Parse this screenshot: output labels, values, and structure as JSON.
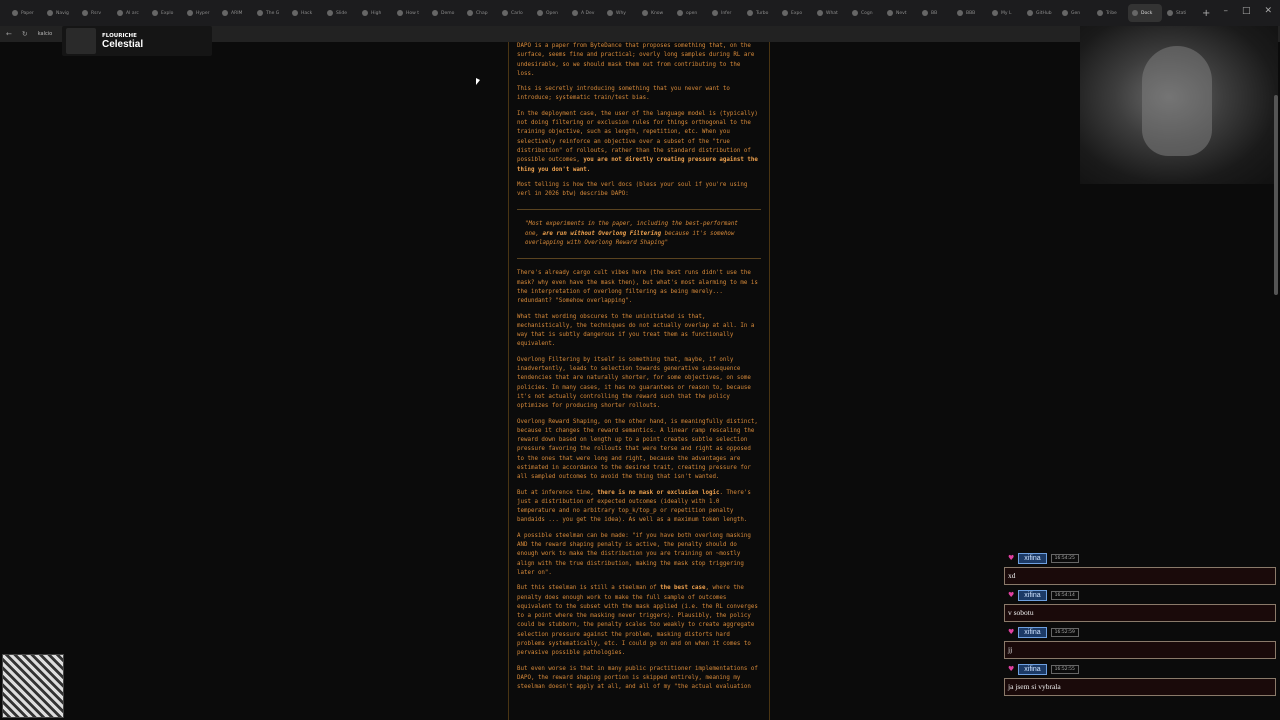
{
  "browser": {
    "tabs": [
      "Paper",
      "Navig",
      "Rsrv",
      "AI arc",
      "Explo",
      "Hyper",
      "ARIM",
      "The G",
      "Hack",
      "Slide",
      "High",
      "How t",
      "Demo",
      "Chap",
      "Carlo",
      "Open",
      "A Dev",
      "Why",
      "Know",
      "open",
      "Infer",
      "Turbo",
      "Expo",
      "What",
      "Cogn",
      "Nevt",
      "BB",
      "BBB",
      "My L",
      "GitHub",
      "Gen",
      "Tribe",
      "Dock",
      "Stati"
    ],
    "address": "kalcio"
  },
  "stream_overlay": {
    "streamer_name": "FLOURICHE",
    "game_title": "Celestial"
  },
  "article": {
    "p1": "DAPO is a paper from ByteDance that proposes something that, on the surface, seems fine and practical; overly long samples during RL are undesirable, so we should mask them out from contributing to the loss.",
    "p2": "This is secretly introducing something that you never want to introduce; systematic train/test bias.",
    "p3_a": "In the deployment case, the user of the language model is (typically) not doing filtering or exclusion rules for things orthogonal to the training objective, such as length, repetition, etc. When you selectively reinforce an objective over a subset of the \"true distribution\" of rollouts, rather than the standard distribution of possible outcomes, ",
    "p3_b": "you are not directly creating pressure against the thing you don't want.",
    "p4": "Most telling is how the verl docs (bless your soul if you're using verl in 2026 btw) describe DAPO:",
    "quote_a": "\"Most experiments in the paper, including the best-performant one, ",
    "quote_b": "are run without Overlong Filtering",
    "quote_c": " because it's somehow overlapping with Overlong Reward Shaping\"",
    "p5": "There's already cargo cult vibes here (the best runs didn't use the mask? why even have the mask then), but what's most alarming to me is the interpretation of overlong filtering as being merely... redundant? \"Somehow overlapping\".",
    "p6": "What that wording obscures to the uninitiated is that, mechanistically, the techniques do not actually overlap at all. In a way that is subtly dangerous if you treat them as functionally equivalent.",
    "p7": "Overlong Filtering by itself is something that, maybe, if only inadvertently, leads to selection towards generative subsequence tendencies that are naturally shorter, for some objectives, on some policies. In many cases, it has no guarantees or reason to, because it's not actually controlling the reward such that the policy optimizes for producing shorter rollouts.",
    "p8": "Overlong Reward Shaping, on the other hand, is meaningfully distinct, because it changes the reward semantics. A linear ramp rescaling the reward down based on length up to a point creates subtle selection pressure favoring the rollouts that were terse and right as opposed to the ones that were long and right, because the advantages are estimated in accordance to the desired trait, creating pressure for all sampled outcomes to avoid the thing that isn't wanted.",
    "p9_a": "But at inference time, ",
    "p9_b": "there is no mask or exclusion logic",
    "p9_c": ". There's just a distribution of expected outcomes (ideally with 1.0 temperature and no arbitrary top_k/top_p or repetition penalty bandaids ... you get the idea). As well as a maximum token length.",
    "p10": "A possible steelman can be made: \"if you have both overlong masking AND the reward shaping penalty is active, the penalty should do enough work to make the distribution you are training on ~mostly align with the true distribution, making the mask stop triggering later on\".",
    "p11_a": "But this steelman is still a steelman of ",
    "p11_b": "the best case",
    "p11_c": ", where the penalty does enough work to make the full sample of outcomes equivalent to the subset with the mask applied (i.e. the RL converges to a point where the masking never triggers). Plausibly, the policy could be stubborn, the penalty scales too weakly to create aggregate selection pressure against the problem, masking distorts hard problems systematically, etc. I could go on and on when it comes to pervasive possible pathologies.",
    "p12": "But even worse is that in many public practitioner implementations of DAPO, the reward shaping portion is skipped entirely, meaning my steelman doesn't apply at all, and all of my \"the actual evaluation"
  },
  "chat": [
    {
      "user": "xifina",
      "time": "16:54:25",
      "message": "xd"
    },
    {
      "user": "xifina",
      "time": "16:54:14",
      "message": "v sobotu"
    },
    {
      "user": "xifina",
      "time": "16:52:59",
      "message": "jj"
    },
    {
      "user": "xifina",
      "time": "16:52:55",
      "message": "ja jsem si vybrala"
    }
  ],
  "icons": {
    "chat_badge": "heart-icon",
    "back": "back-arrow-icon",
    "reload": "reload-icon"
  },
  "colors": {
    "article_text": "#d98b3a",
    "article_border": "#4a3513",
    "chat_user_bg": "#1c3a66"
  }
}
